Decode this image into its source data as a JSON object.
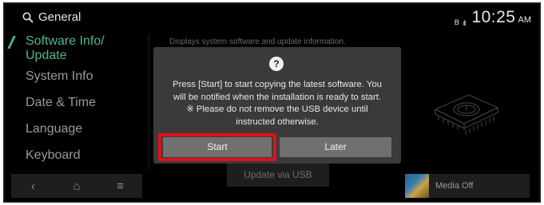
{
  "header": {
    "title": "General",
    "bluetooth": "ʙ",
    "signal": "ıll",
    "time": "10:25",
    "ampm": "AM"
  },
  "sidebar": {
    "items": [
      {
        "label_line1": "Software Info/",
        "label_line2": "Update",
        "active": true
      },
      {
        "label": "System Info"
      },
      {
        "label": "Date & Time"
      },
      {
        "label": "Language"
      },
      {
        "label": "Keyboard"
      }
    ]
  },
  "content": {
    "description": "Displays system software and update information."
  },
  "dialog": {
    "icon": "?",
    "message_lines": [
      "Press [Start] to start copying the latest software. You",
      "will be notified when the installation is ready to start.",
      "※ Please do not remove the USB device until",
      "instructed otherwise."
    ],
    "start_label": "Start",
    "later_label": "Later"
  },
  "bottombar": {
    "back_icon": "‹",
    "home_icon": "⌂",
    "menu_icon": "≡",
    "update_label": "Update via USB",
    "media_label": "Media Off"
  },
  "colors": {
    "accent": "#4db88d",
    "highlight": "#e0101a",
    "dialog_bg": "#3a3a3a",
    "button_bg": "#707070"
  }
}
